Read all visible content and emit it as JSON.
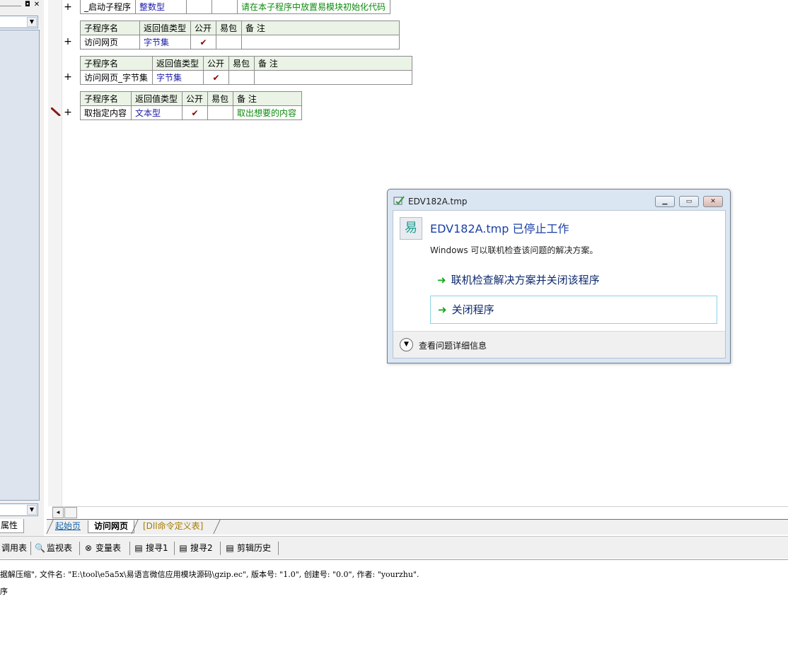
{
  "left_panel": {
    "pin_glyph": "◘",
    "close_glyph": "✕",
    "combo_arrow": "▼",
    "attr_tab": "属性"
  },
  "subroutines": [
    {
      "header": [
        "",
        "",
        "",
        "",
        ""
      ],
      "row": [
        "_启动子程序",
        "整数型",
        "",
        "",
        "请在本子程序中放置易模块初始化代码"
      ]
    },
    {
      "header": [
        "子程序名",
        "返回值类型",
        "公开",
        "易包",
        "备 注"
      ],
      "row": [
        "访问网页",
        "字节集",
        "✔",
        "",
        ""
      ]
    },
    {
      "header": [
        "子程序名",
        "返回值类型",
        "公开",
        "易包",
        "备 注"
      ],
      "row": [
        "访问网页_字节集",
        "字节集",
        "✔",
        "",
        ""
      ]
    },
    {
      "header": [
        "子程序名",
        "返回值类型",
        "公开",
        "易包",
        "备 注"
      ],
      "row": [
        "取指定内容",
        "文本型",
        "✔",
        "",
        "取出想要的内容"
      ]
    }
  ],
  "plus_glyph": "+",
  "scroll_left_glyph": "◂",
  "tabs": {
    "start": "起始页",
    "visit": "访问网页",
    "dll": "[Dll命令定义表]"
  },
  "toolbar": {
    "call_table": "调用表",
    "monitor": "监视表",
    "variables": "变量表",
    "search1": "搜寻1",
    "search2": "搜寻2",
    "clip_history": "剪辑历史",
    "search_icon": "🔍",
    "var_icon": "⊗",
    "doc_icon": "▤"
  },
  "output": {
    "line1": "据解压缩\", 文件名: \"E:\\tool\\e5a5x\\易语言微信应用模块源码\\gzip.ec\", 版本号: \"1.0\", 创建号: \"0.0\", 作者: \"yourzhu\".",
    "line2": "序"
  },
  "dialog": {
    "title": "EDV182A.tmp",
    "heading": "EDV182A.tmp 已停止工作",
    "sub": "Windows 可以联机检查该问题的解决方案。",
    "option_online": "联机检查解决方案并关闭该程序",
    "option_close": "关闭程序",
    "details": "查看问题详细信息",
    "arrow_glyph": "➜",
    "expand_glyph": "▼",
    "min_glyph": "▁",
    "max_glyph": "▭",
    "close_glyph": "✕",
    "app_icon_glyph": "易"
  },
  "colors": {
    "header_bg": "#eaf3e6",
    "type_text": "#1c1ca8",
    "note_text": "#0d8a0d",
    "dialog_heading": "#1a3fa6",
    "arrow": "#16a616"
  }
}
